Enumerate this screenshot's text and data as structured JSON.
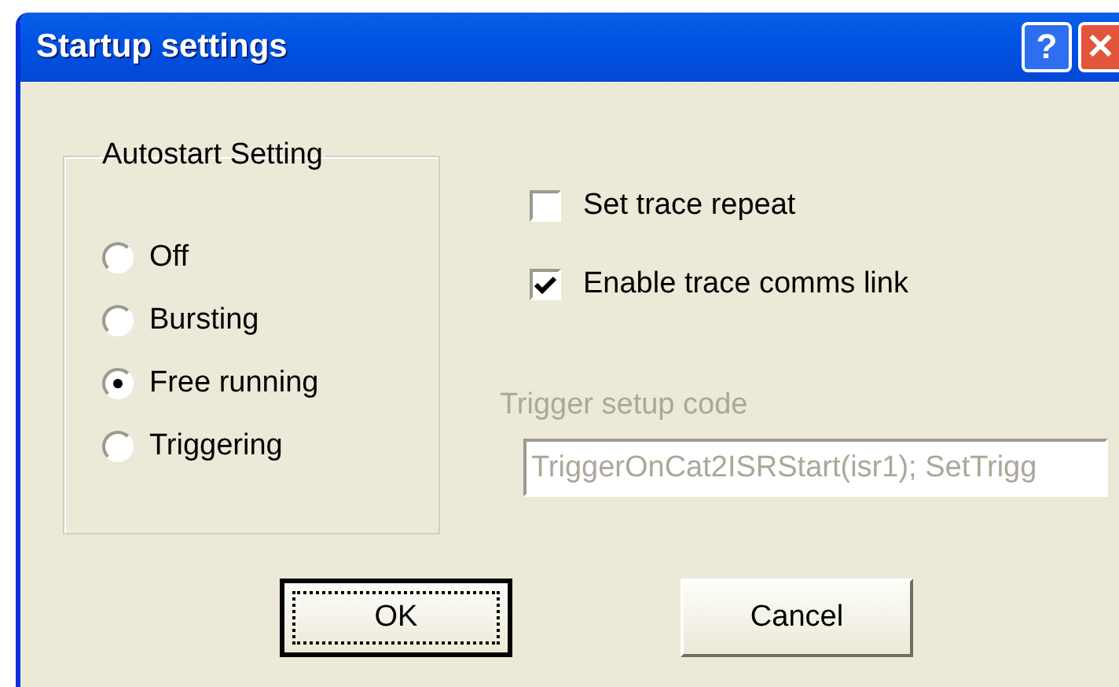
{
  "window": {
    "title": "Startup settings",
    "help_button": "?",
    "close_button": "✕"
  },
  "autostart": {
    "legend": "Autostart Setting",
    "options": [
      {
        "label": "Off",
        "selected": false
      },
      {
        "label": "Bursting",
        "selected": false
      },
      {
        "label": "Free running",
        "selected": true
      },
      {
        "label": "Triggering",
        "selected": false
      }
    ]
  },
  "checkboxes": [
    {
      "label": "Set trace repeat",
      "checked": false
    },
    {
      "label": "Enable trace comms link",
      "checked": true
    }
  ],
  "trigger": {
    "label": "Trigger setup code",
    "value": "TriggerOnCat2ISRStart(isr1); SetTrigg",
    "disabled": true
  },
  "buttons": [
    {
      "label": "OK",
      "default": true
    },
    {
      "label": "Cancel",
      "default": false
    }
  ]
}
